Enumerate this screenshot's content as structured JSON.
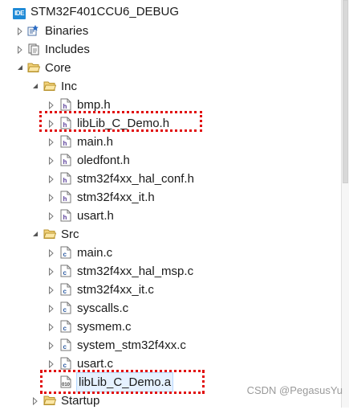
{
  "project": {
    "title": "STM32F401CCU6_DEBUG",
    "icon": "ide-project-icon",
    "icon_text": "IDE"
  },
  "nodes": {
    "binaries": "Binaries",
    "includes": "Includes",
    "core": "Core",
    "inc": "Inc",
    "inc_files": [
      "bmp.h",
      "libLib_C_Demo.h",
      "main.h",
      "oledfont.h",
      "stm32f4xx_hal_conf.h",
      "stm32f4xx_it.h",
      "usart.h"
    ],
    "src": "Src",
    "src_files": [
      "main.c",
      "stm32f4xx_hal_msp.c",
      "stm32f4xx_it.c",
      "syscalls.c",
      "sysmem.c",
      "system_stm32f4xx.c",
      "usart.c"
    ],
    "lib_file": "libLib_C_Demo.a",
    "startup": "Startup"
  },
  "icons": {
    "header": "h-file-icon",
    "source": "c-file-icon",
    "library": "lib-archive-icon",
    "folder": "folder-icon",
    "binaries": "binaries-icon",
    "includes": "includes-icon"
  },
  "colors": {
    "highlight": "#e10c0c",
    "selection": "#e5f1ff",
    "badge": "#1f8ad6"
  },
  "watermark": "CSDN @PegasusYu"
}
